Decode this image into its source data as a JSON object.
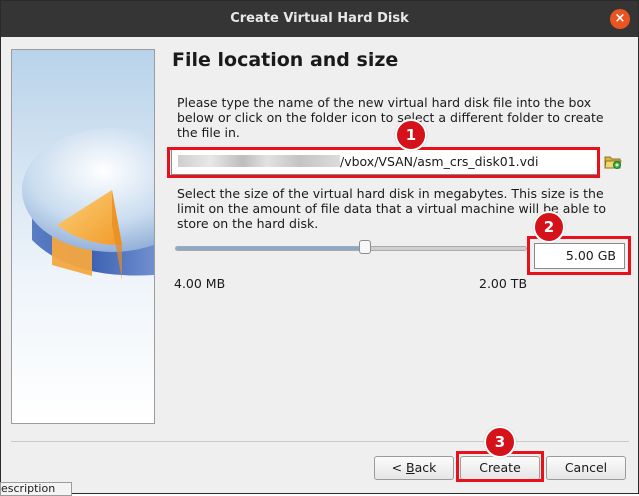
{
  "window": {
    "title": "Create Virtual Hard Disk",
    "close_glyph": "×"
  },
  "page": {
    "heading": "File location and size",
    "location_text": "Please type the name of the new virtual hard disk file into the box below or click on the folder icon to select a different folder to create the file in.",
    "path_visible_suffix": "/vbox/VSAN/asm_crs_disk01.vdi",
    "size_text": "Select the size of the virtual hard disk in megabytes. This size is the limit on the amount of file data that a virtual machine will be able to store on the hard disk.",
    "size_value": "5.00 GB",
    "slider_fraction": 0.54,
    "min_label": "4.00 MB",
    "max_label": "2.00 TB"
  },
  "buttons": {
    "back_prefix": "< ",
    "back_mnemonic": "B",
    "back_rest": "ack",
    "create": "Create",
    "cancel": "Cancel"
  },
  "annotations": {
    "badge1": "1",
    "badge2": "2",
    "badge3": "3",
    "color": "#e8101a"
  },
  "background": {
    "partial_label": "escription"
  }
}
